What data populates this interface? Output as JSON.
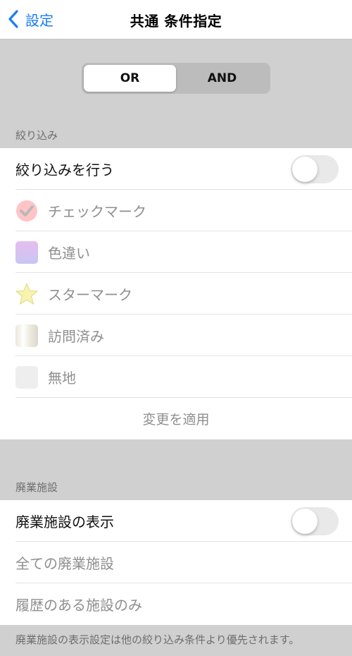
{
  "nav": {
    "back_label": "設定",
    "title": "共通 条件指定"
  },
  "segment": {
    "options": [
      "OR",
      "AND"
    ],
    "selected": "OR"
  },
  "filter_section": {
    "header": "絞り込み",
    "toggle_label": "絞り込みを行う",
    "toggle_on": false,
    "items": [
      {
        "label": "チェックマーク",
        "icon": "checkmark-icon",
        "color": "#ff9aa0"
      },
      {
        "label": "色違い",
        "icon": "color-swatch-icon",
        "color": "#d6b8f2"
      },
      {
        "label": "スターマーク",
        "icon": "star-icon",
        "color": "#f6f2a6"
      },
      {
        "label": "訪問済み",
        "icon": "visited-swatch-icon",
        "color": "#f0eee6"
      },
      {
        "label": "無地",
        "icon": "plain-swatch-icon",
        "color": "#eeeeee"
      }
    ],
    "apply_label": "変更を適用"
  },
  "closed_section": {
    "header": "廃業施設",
    "toggle_label": "廃業施設の表示",
    "toggle_on": false,
    "options": [
      "全ての廃業施設",
      "履歴のある施設のみ"
    ],
    "footer": "廃業施設の表示設定は他の絞り込み条件より優先されます。"
  },
  "colors": {
    "accent": "#1a7cf5",
    "background": "#d0d0d0",
    "cell": "#ffffff",
    "muted_text": "#8f8f8f"
  }
}
